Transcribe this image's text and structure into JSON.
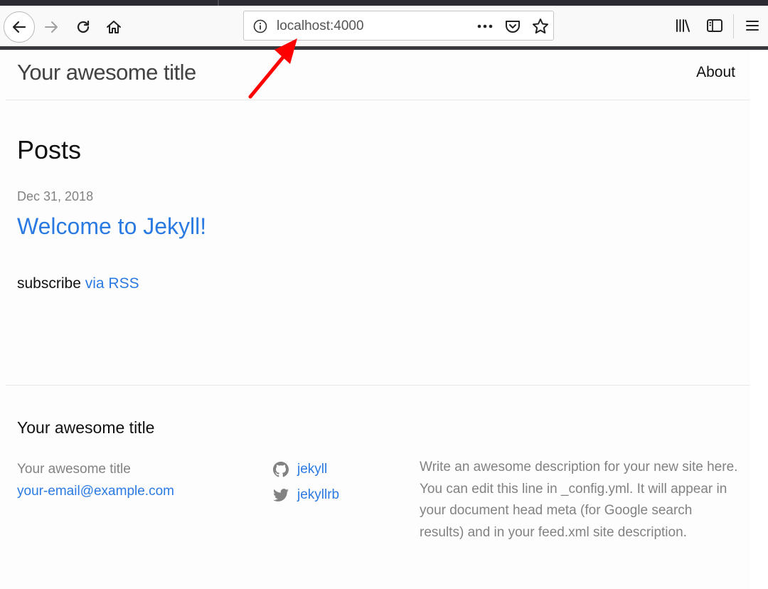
{
  "browser": {
    "url": "localhost:4000"
  },
  "site": {
    "title": "Your awesome title",
    "nav": {
      "about": "About"
    }
  },
  "main": {
    "heading": "Posts",
    "posts": [
      {
        "date": "Dec 31, 2018",
        "title": "Welcome to Jekyll!"
      }
    ],
    "subscribe": {
      "prefix": "subscribe ",
      "link": "via RSS"
    }
  },
  "footer": {
    "heading": "Your awesome title",
    "name": "Your awesome title",
    "email": "your-email@example.com",
    "github": "jekyll",
    "twitter": "jekyllrb",
    "description": "Write an awesome description for your new site here. You can edit this line in _config.yml. It will appear in your document head meta (for Google search results) and in your feed.xml site description."
  },
  "colors": {
    "link": "#2a7ae2",
    "annotation": "#ff0000"
  }
}
